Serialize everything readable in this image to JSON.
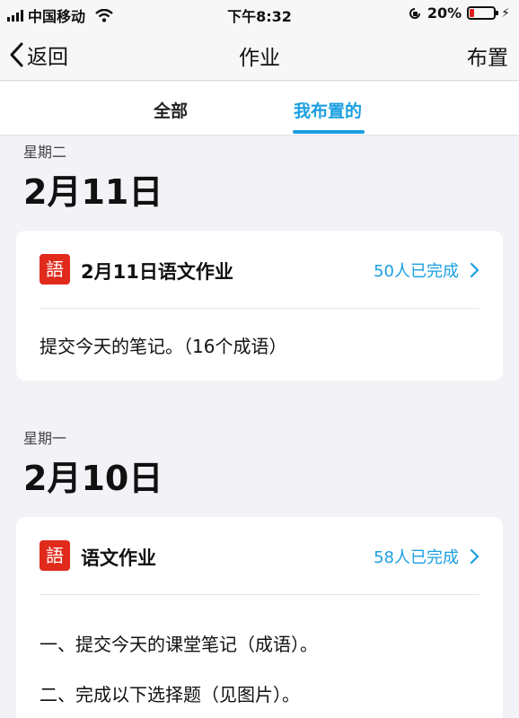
{
  "status_bar": {
    "carrier": "中国移动",
    "time": "下午8:32",
    "battery_percent": "20%",
    "battery_level": 0.2,
    "icons": [
      "signal-icon",
      "wifi-icon",
      "orientation-lock-icon",
      "battery-icon",
      "charging-icon"
    ]
  },
  "nav": {
    "back_label": "返回",
    "title": "作业",
    "action_label": "布置"
  },
  "tabs": [
    {
      "label": "全部",
      "selected": false
    },
    {
      "label": "我布置的",
      "selected": true
    }
  ],
  "accent_color": "#1a9fe0",
  "subject_icon_color": "#e02a1c",
  "sections": [
    {
      "day": "星期二",
      "date": "2月11日",
      "card": {
        "icon_glyph": "語",
        "title": "2月11日语文作业",
        "completion": "50人已完成",
        "lines": [
          "提交今天的笔记。（16个成语）"
        ]
      }
    },
    {
      "day": "星期一",
      "date": "2月10日",
      "card": {
        "icon_glyph": "語",
        "title": "语文作业",
        "completion": "58人已完成",
        "lines": [
          "一、提交今天的课堂笔记（成语）。",
          "二、完成以下选择题（见图片）。"
        ]
      }
    }
  ]
}
